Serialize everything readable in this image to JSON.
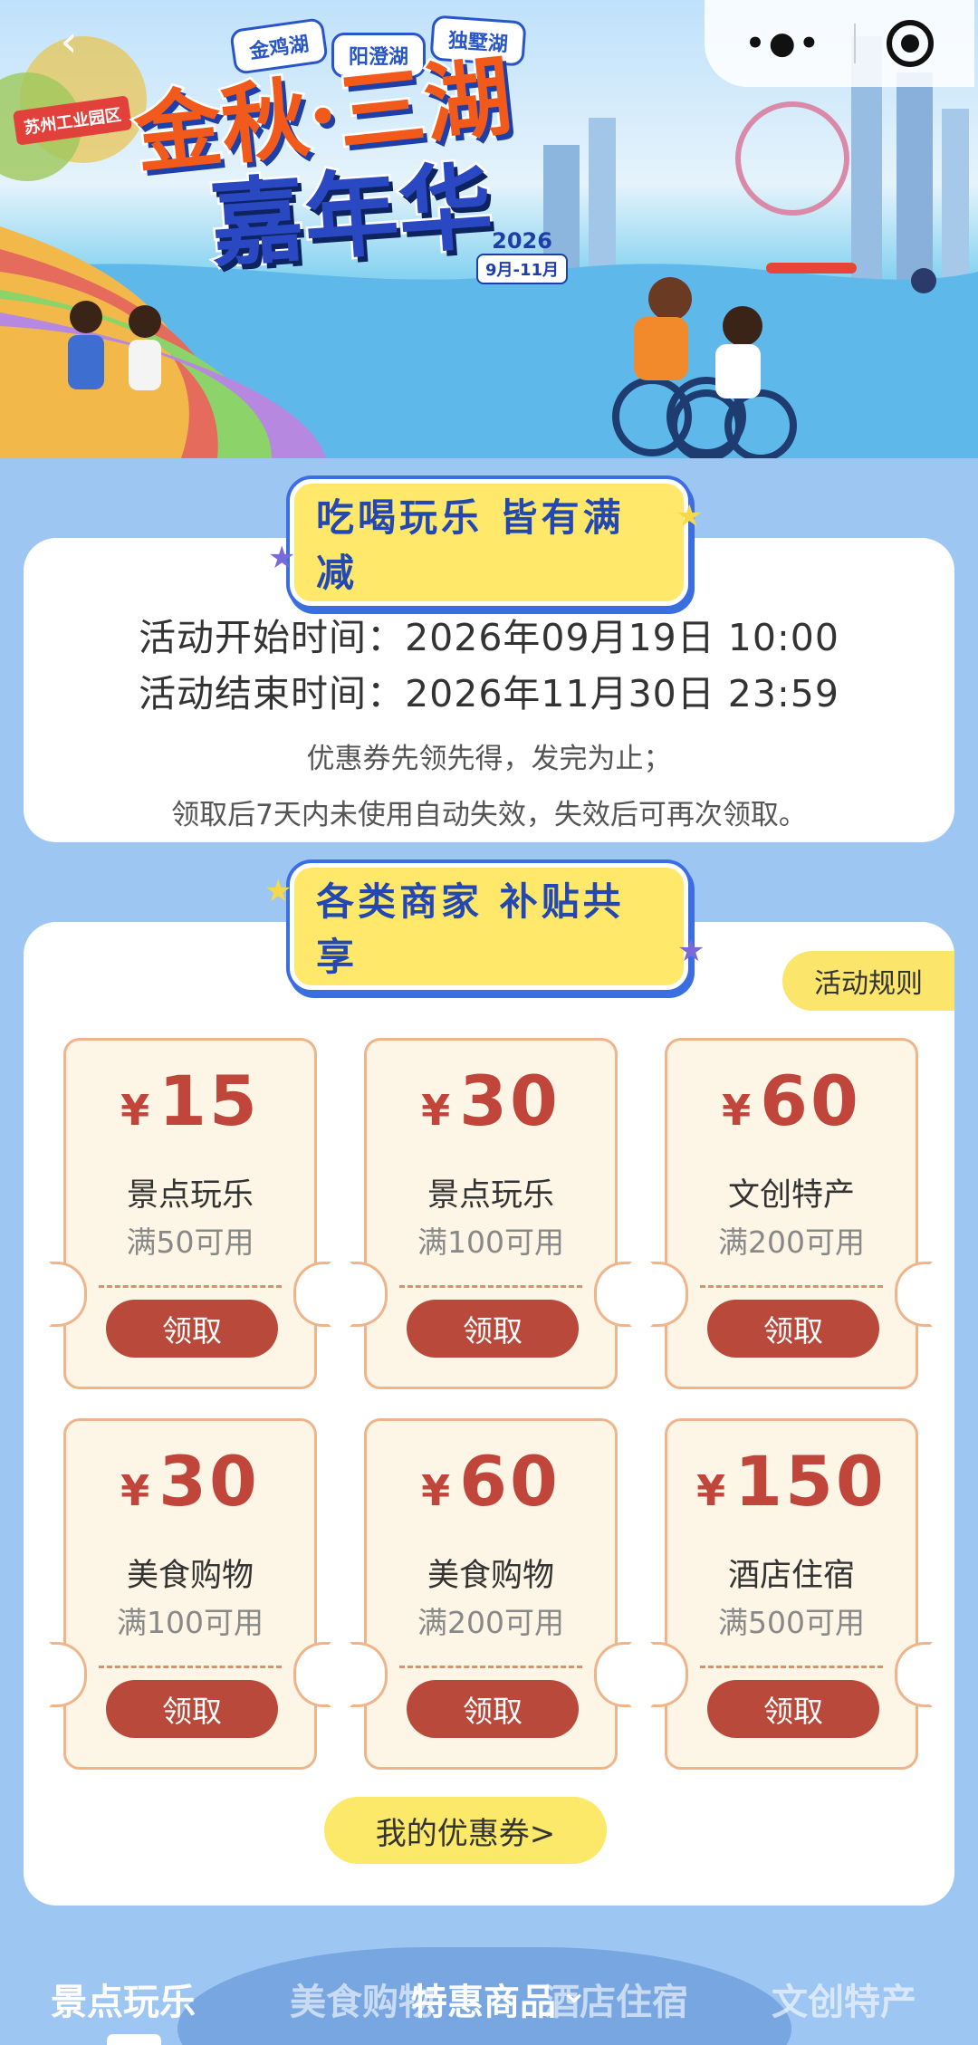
{
  "banner": {
    "back_glyph": "‹",
    "capsule_menu": "•●•",
    "park_tag": "苏州工业园区",
    "lakes": [
      "金鸡湖",
      "阳澄湖",
      "独墅湖"
    ],
    "title_main": "金秋·三湖",
    "title_sub": "嘉年华",
    "year": "2026",
    "date_range": "9月-11月"
  },
  "activity": {
    "ribbon": "吃喝玩乐 皆有满减",
    "start_label": "活动开始时间：",
    "start_value": "2026年09月19日 10:00",
    "end_label": "活动结束时间：",
    "end_value": "2026年11月30日 23:59",
    "note1": "优惠券先领先得，发完为止；",
    "note2": "领取后7天内未使用自动失效，失效后可再次领取。"
  },
  "coupons_section": {
    "ribbon": "各类商家 补贴共享",
    "rules_label": "活动规则",
    "currency": "¥",
    "claim_label": "领取",
    "items": [
      {
        "amount": "15",
        "category": "景点玩乐",
        "condition": "满50可用"
      },
      {
        "amount": "30",
        "category": "景点玩乐",
        "condition": "满100可用"
      },
      {
        "amount": "60",
        "category": "文创特产",
        "condition": "满200可用"
      },
      {
        "amount": "30",
        "category": "美食购物",
        "condition": "满100可用"
      },
      {
        "amount": "60",
        "category": "美食购物",
        "condition": "满200可用"
      },
      {
        "amount": "150",
        "category": "酒店住宿",
        "condition": "满500可用"
      }
    ],
    "my_coupons_label": "我的优惠券>"
  },
  "bottom_nav": {
    "items": [
      "景点玩乐",
      "美食购物",
      "酒店住宿",
      "文创特产"
    ],
    "special": "特惠商品",
    "special_chevron": "⌄"
  }
}
